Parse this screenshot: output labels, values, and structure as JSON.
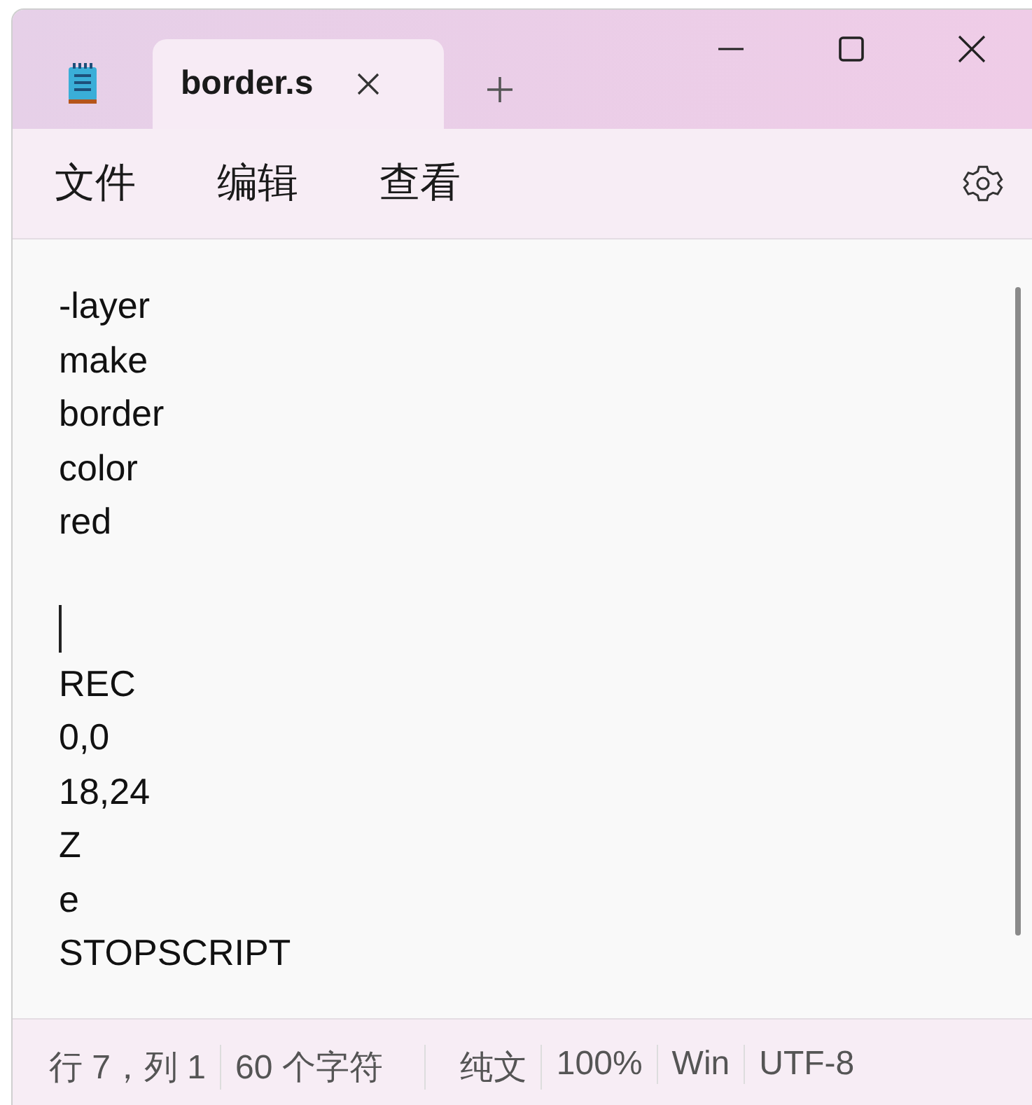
{
  "tabs": [
    {
      "title": "border.s",
      "selected": true
    }
  ],
  "menu": [
    "文件",
    "编辑",
    "查看"
  ],
  "lines": [
    {
      "kind": "text",
      "text": "-layer",
      "caret": false
    },
    {
      "kind": "text",
      "text": "make",
      "caret": false
    },
    {
      "kind": "text",
      "text": "border",
      "caret": false
    },
    {
      "kind": "text",
      "text": "color",
      "caret": false
    },
    {
      "kind": "text",
      "text": "red",
      "caret": false
    },
    {
      "kind": "blank",
      "caret": false
    },
    {
      "kind": "blank",
      "caret": true
    },
    {
      "kind": "text",
      "text": "REC",
      "caret": false
    },
    {
      "kind": "text",
      "text": "0,0",
      "caret": false
    },
    {
      "kind": "text",
      "text": "18,24",
      "caret": false
    },
    {
      "kind": "text",
      "text": "Z",
      "caret": false
    },
    {
      "kind": "text",
      "text": "e",
      "caret": false
    },
    {
      "kind": "text",
      "text": "STOPSCRIPT",
      "caret": false
    }
  ],
  "status_bar": [
    "行 7，列 1",
    "60 个字符",
    "纯文",
    "100%",
    "Win",
    "UTF-8"
  ]
}
